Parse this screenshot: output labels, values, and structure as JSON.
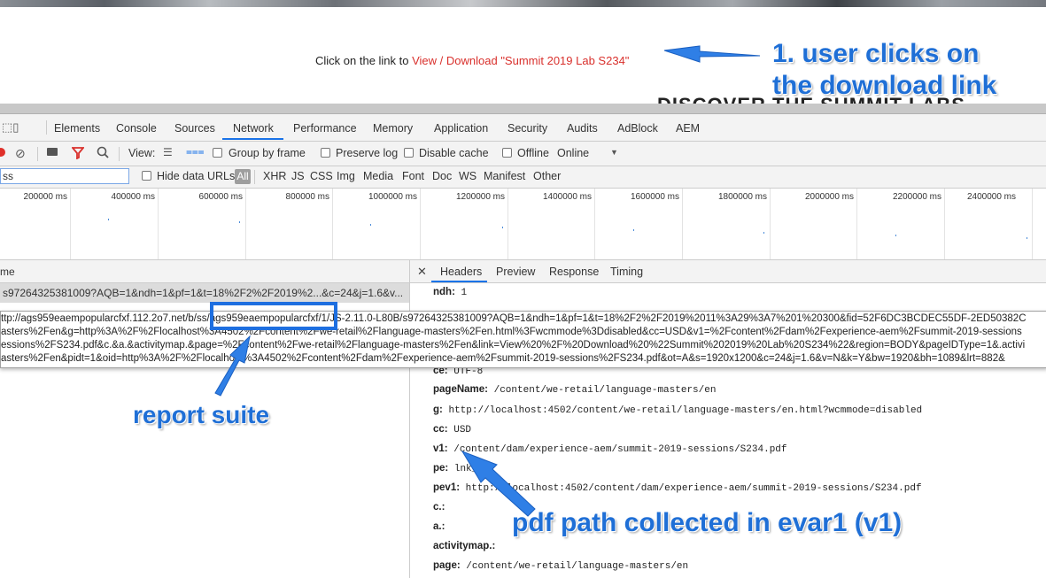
{
  "page": {
    "text_prefix": "Click on the link to ",
    "link_text": "View / Download \"Summit 2019 Lab S234\"",
    "heading_behind": "DISCOVER THE SUMMIT LABS"
  },
  "devtools": {
    "tabs": [
      "Elements",
      "Console",
      "Sources",
      "Network",
      "Performance",
      "Memory",
      "Application",
      "Security",
      "Audits",
      "AdBlock",
      "AEM"
    ],
    "active_tab": "Network",
    "toolbar": {
      "view_label": "View:",
      "group_by_frame": "Group by frame",
      "preserve_log": "Preserve log",
      "disable_cache": "Disable cache",
      "offline": "Offline",
      "online": "Online"
    },
    "filter": {
      "value": "ss",
      "hide_data_urls": "Hide data URLs",
      "all": "All",
      "types": [
        "XHR",
        "JS",
        "CSS",
        "Img",
        "Media",
        "Font",
        "Doc",
        "WS",
        "Manifest",
        "Other"
      ]
    },
    "timeline_ticks": [
      "200000 ms",
      "400000 ms",
      "600000 ms",
      "800000 ms",
      "1000000 ms",
      "1200000 ms",
      "1400000 ms",
      "1600000 ms",
      "1800000 ms",
      "2000000 ms",
      "2200000 ms",
      "2400000 ms"
    ],
    "requests": {
      "name_header": "me",
      "row": "s97264325381009?AQB=1&ndh=1&pf=1&t=18%2F2%2F2019%2...&c=24&j=1.6&v..."
    },
    "detail_tabs": [
      "Headers",
      "Preview",
      "Response",
      "Timing"
    ],
    "tooltip_lines": [
      "ttp://ags959eaempopularcfxf.112.2o7.net/b/ss/ags959eaempopularcfxf/1/JS-2.11.0-L80B/s97264325381009?AQB=1&ndh=1&pf=1&t=18%2F2%2F2019%2011%3A29%3A7%201%20300&fid=52F6DC3BCDEC55DF-2ED50382C",
      "asters%2Fen&g=http%3A%2F%2Flocalhost%3A4502%2Fcontent%2Fwe-retail%2Flanguage-masters%2Fen.html%3Fwcmmode%3Ddisabled&cc=USD&v1=%2Fcontent%2Fdam%2Fexperience-aem%2Fsummit-2019-sessions",
      "essions%2FS234.pdf&c.&a.&activitymap.&page=%2Fcontent%2Fwe-retail%2Flanguage-masters%2Fen&link=View%20%2F%20Download%20%22Summit%202019%20Lab%20S234%22&region=BODY&pageIDType=1&.activi",
      "asters%2Fen&pidt=1&oid=http%3A%2F%2Flocalhost%3A4502%2Fcontent%2Fdam%2Fexperience-aem%2Fsummit-2019-sessions%2FS234.pdf&ot=A&s=1920x1200&c=24&j=1.6&v=N&k=Y&bw=1920&bh=1089&lrt=882&"
    ],
    "headers": [
      {
        "key": "ndh:",
        "val": "1"
      },
      {
        "key": "ce:",
        "val": "UTF-8"
      },
      {
        "key": "pageName:",
        "val": "/content/we-retail/language-masters/en"
      },
      {
        "key": "g:",
        "val": "http://localhost:4502/content/we-retail/language-masters/en.html?wcmmode=disabled"
      },
      {
        "key": "cc:",
        "val": "USD"
      },
      {
        "key": "v1:",
        "val": "/content/dam/experience-aem/summit-2019-sessions/S234.pdf"
      },
      {
        "key": "pe:",
        "val": "lnk_o"
      },
      {
        "key": "pev1:",
        "val": "http://localhost:4502/content/dam/experience-aem/summit-2019-sessions/S234.pdf"
      },
      {
        "key": "c.:",
        "val": ""
      },
      {
        "key": "a.:",
        "val": ""
      },
      {
        "key": "activitymap.:",
        "val": ""
      },
      {
        "key": "page:",
        "val": "/content/we-retail/language-masters/en"
      }
    ]
  },
  "annotations": {
    "step1_line1": "1. user clicks on",
    "step1_line2": "the download link",
    "report_suite": "report suite",
    "pdf_path": "pdf path collected in evar1 (v1)",
    "color": "#1f6fd6"
  }
}
